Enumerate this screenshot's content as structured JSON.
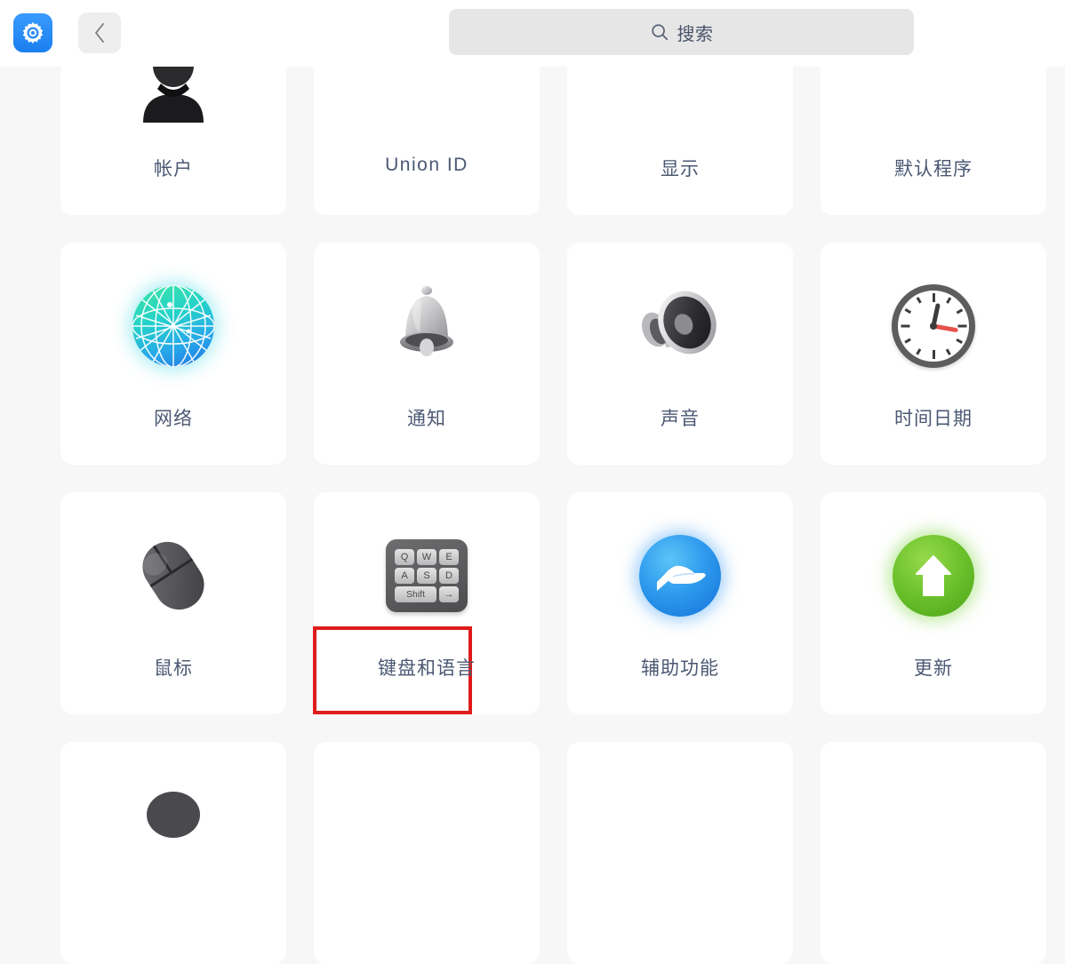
{
  "window": {
    "app_icon": "settings-gear-icon",
    "back_icon": "chevron-left-icon"
  },
  "search": {
    "icon": "search-icon",
    "placeholder": "搜索"
  },
  "grid": {
    "rows": [
      {
        "row_index": 1,
        "clipped": true,
        "items": [
          {
            "label": "帐户",
            "icon": "account-icon",
            "script": "cjk"
          },
          {
            "label": "Union ID",
            "icon": "union-id-icon",
            "script": "latin"
          },
          {
            "label": "显示",
            "icon": "display-icon",
            "script": "cjk"
          },
          {
            "label": "默认程序",
            "icon": "default-applications-icon",
            "script": "cjk"
          }
        ]
      },
      {
        "row_index": 2,
        "clipped": false,
        "items": [
          {
            "label": "网络",
            "icon": "network-globe-icon",
            "script": "cjk"
          },
          {
            "label": "通知",
            "icon": "notification-bell-icon",
            "script": "cjk"
          },
          {
            "label": "声音",
            "icon": "sound-speaker-icon",
            "script": "cjk"
          },
          {
            "label": "时间日期",
            "icon": "datetime-clock-icon",
            "script": "cjk"
          }
        ]
      },
      {
        "row_index": 3,
        "clipped": false,
        "items": [
          {
            "label": "鼠标",
            "icon": "mouse-icon",
            "script": "cjk"
          },
          {
            "label": "键盘和语言",
            "icon": "keyboard-icon",
            "script": "cjk",
            "highlighted": true
          },
          {
            "label": "辅助功能",
            "icon": "accessibility-hand-icon",
            "script": "cjk"
          },
          {
            "label": "更新",
            "icon": "update-arrow-icon",
            "script": "cjk"
          }
        ]
      }
    ],
    "partial_bottom_row_visible": true
  },
  "keyboard_icon_keys": {
    "row1": [
      "Q",
      "W",
      "E"
    ],
    "row2": [
      "A",
      "S",
      "D"
    ],
    "row3": [
      "Shift",
      "→"
    ]
  },
  "annotation": {
    "type": "selection-box",
    "color": "#e01b1b",
    "target_label": "键盘和语言"
  },
  "colors": {
    "page_background": "#f7f7f8",
    "titlebar_background": "#ffffff",
    "card_background": "#ffffff",
    "label_text": "#4b5873",
    "search_background": "#e6e6e7",
    "accent_blue": "#1a7ef0",
    "highlight_red": "#e01b1b"
  }
}
